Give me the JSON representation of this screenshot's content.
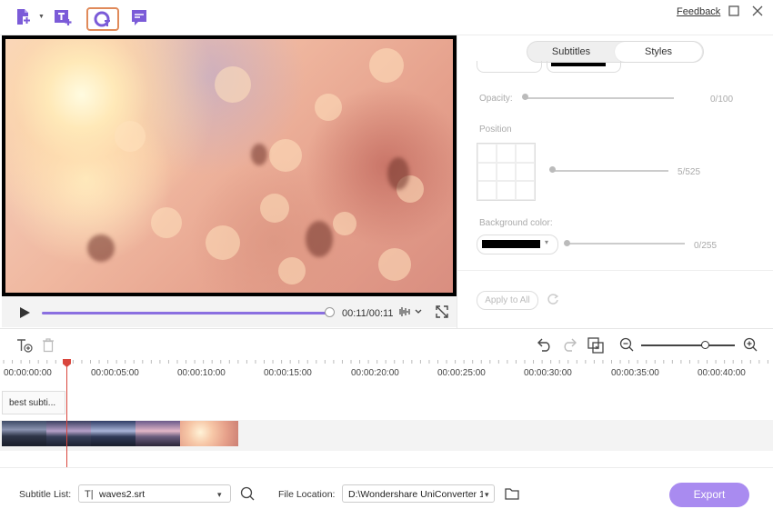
{
  "toolbar": {
    "icons": [
      "add-file-icon",
      "add-subtitle-icon",
      "auto-subtitle-icon",
      "subtitle-editor-icon"
    ],
    "feedback": "Feedback"
  },
  "player": {
    "time": "00:11/00:11",
    "progress": 1.0
  },
  "panel": {
    "tabs": [
      "Subtitles",
      "Styles"
    ],
    "active_tab": "Styles",
    "opacity_label": "Opacity:",
    "opacity_value": "0/100",
    "position_label": "Position",
    "position_value": "5/525",
    "bg_label": "Background color:",
    "bg_value": "0/255",
    "apply_all": "Apply to All"
  },
  "timeline": {
    "ticks": [
      "00:00:00:00",
      "00:00:05:00",
      "00:00:10:00",
      "00:00:15:00",
      "00:00:20:00",
      "00:00:25:00",
      "00:00:30:00",
      "00:00:35:00",
      "00:00:40:00"
    ],
    "subtitle_clip": "best subti..."
  },
  "bottom": {
    "subtitle_list_label": "Subtitle List:",
    "subtitle_file": "waves2.srt",
    "file_location_label": "File Location:",
    "file_location": "D:\\Wondershare UniConverter 1",
    "export": "Export"
  },
  "colors": {
    "accent": "#a98bf0",
    "progress": "#8a6fe0",
    "playhead": "#d9463d",
    "active_tool_border": "#e08a5a"
  }
}
